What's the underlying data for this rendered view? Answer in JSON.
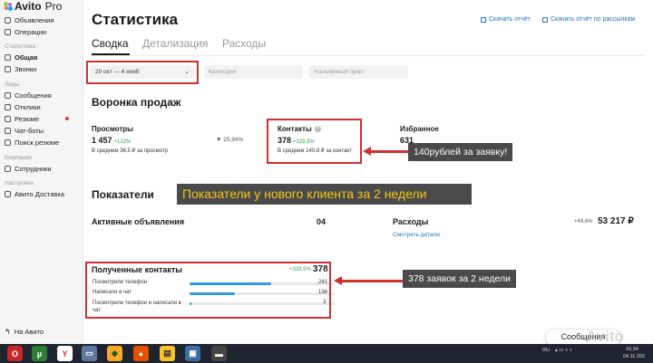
{
  "sidebar": {
    "brand": "Avito",
    "brand_suffix": "Pro",
    "items_top": [
      {
        "label": "Объявления",
        "icon": "ads-icon"
      },
      {
        "label": "Операции",
        "icon": "operations-icon"
      }
    ],
    "section_stats": "Статистика",
    "items_stats": [
      {
        "label": "Общая",
        "icon": "chart-icon"
      },
      {
        "label": "Звонки",
        "icon": "phone-icon"
      }
    ],
    "section_leads": "Лиды",
    "items_leads": [
      {
        "label": "Сообщения",
        "icon": "message-icon"
      },
      {
        "label": "Отклики",
        "icon": "response-icon"
      },
      {
        "label": "Резюме",
        "icon": "resume-icon"
      },
      {
        "label": "Чат-боты",
        "icon": "bot-icon"
      },
      {
        "label": "Поиск резюме",
        "icon": "search-icon"
      }
    ],
    "section_company": "Компания",
    "items_company": [
      {
        "label": "Сотрудники",
        "icon": "team-icon"
      }
    ],
    "section_settings": "Настройки",
    "items_settings": [
      {
        "label": "Авито Доставка",
        "icon": "delivery-icon"
      }
    ],
    "back_link": "На Авито"
  },
  "header": {
    "title": "Статистика",
    "download_report": "Скачать отчёт",
    "download_mailing": "Скачать отчёт по рассылкам"
  },
  "tabs": [
    "Сводка",
    "Детализация",
    "Расходы"
  ],
  "filters": {
    "date": "20 окт — 4 нояб",
    "category_placeholder": "Категория",
    "location_placeholder": "Населённый пункт"
  },
  "funnel": {
    "title": "Воронка продаж",
    "views": {
      "label": "Просмотры",
      "value": "1 457",
      "growth": "+132%",
      "avg": "В среднем 36.5 ₽ за просмотр"
    },
    "conversion": "25,94%",
    "contacts": {
      "label": "Контакты",
      "value": "378",
      "growth": "+329,5%",
      "avg": "В среднем 140.8 ₽ за контакт"
    },
    "favorites": {
      "label": "Избранное",
      "value": "631"
    }
  },
  "annotations": {
    "price_callout": "140рублей за заявку!",
    "banner": "Показатели у нового клиента за 2 недели",
    "contacts_callout": "378 заявок за 2 недели"
  },
  "indicators": {
    "title": "Показатели",
    "active_ads_label": "Активные объявления",
    "active_ads_value": "04",
    "expenses_label": "Расходы",
    "expenses_growth": "+49,6%",
    "expenses_value": "53 217 ₽",
    "details_link": "Смотреть детали"
  },
  "received": {
    "title": "Полученные контакты",
    "growth": "+329,5%",
    "total": "378",
    "rows": [
      {
        "label": "Посмотрели телефон",
        "value": "241",
        "share": 0.64
      },
      {
        "label": "Написали в чат",
        "value": "134",
        "share": 0.36
      },
      {
        "label": "Посмотрели телефон и написали в чат",
        "value": "3",
        "share": 0.01
      }
    ]
  },
  "messages_button": "Сообщения",
  "watermark": "Avito",
  "taskbar": {
    "lang": "RU",
    "time": "16:34",
    "date": "04.11.202"
  },
  "colors": {
    "accent": "#2a9ae0",
    "annotation": "#d32f2f",
    "growth": "#2e9e4f",
    "banner_text": "#f5c518"
  }
}
